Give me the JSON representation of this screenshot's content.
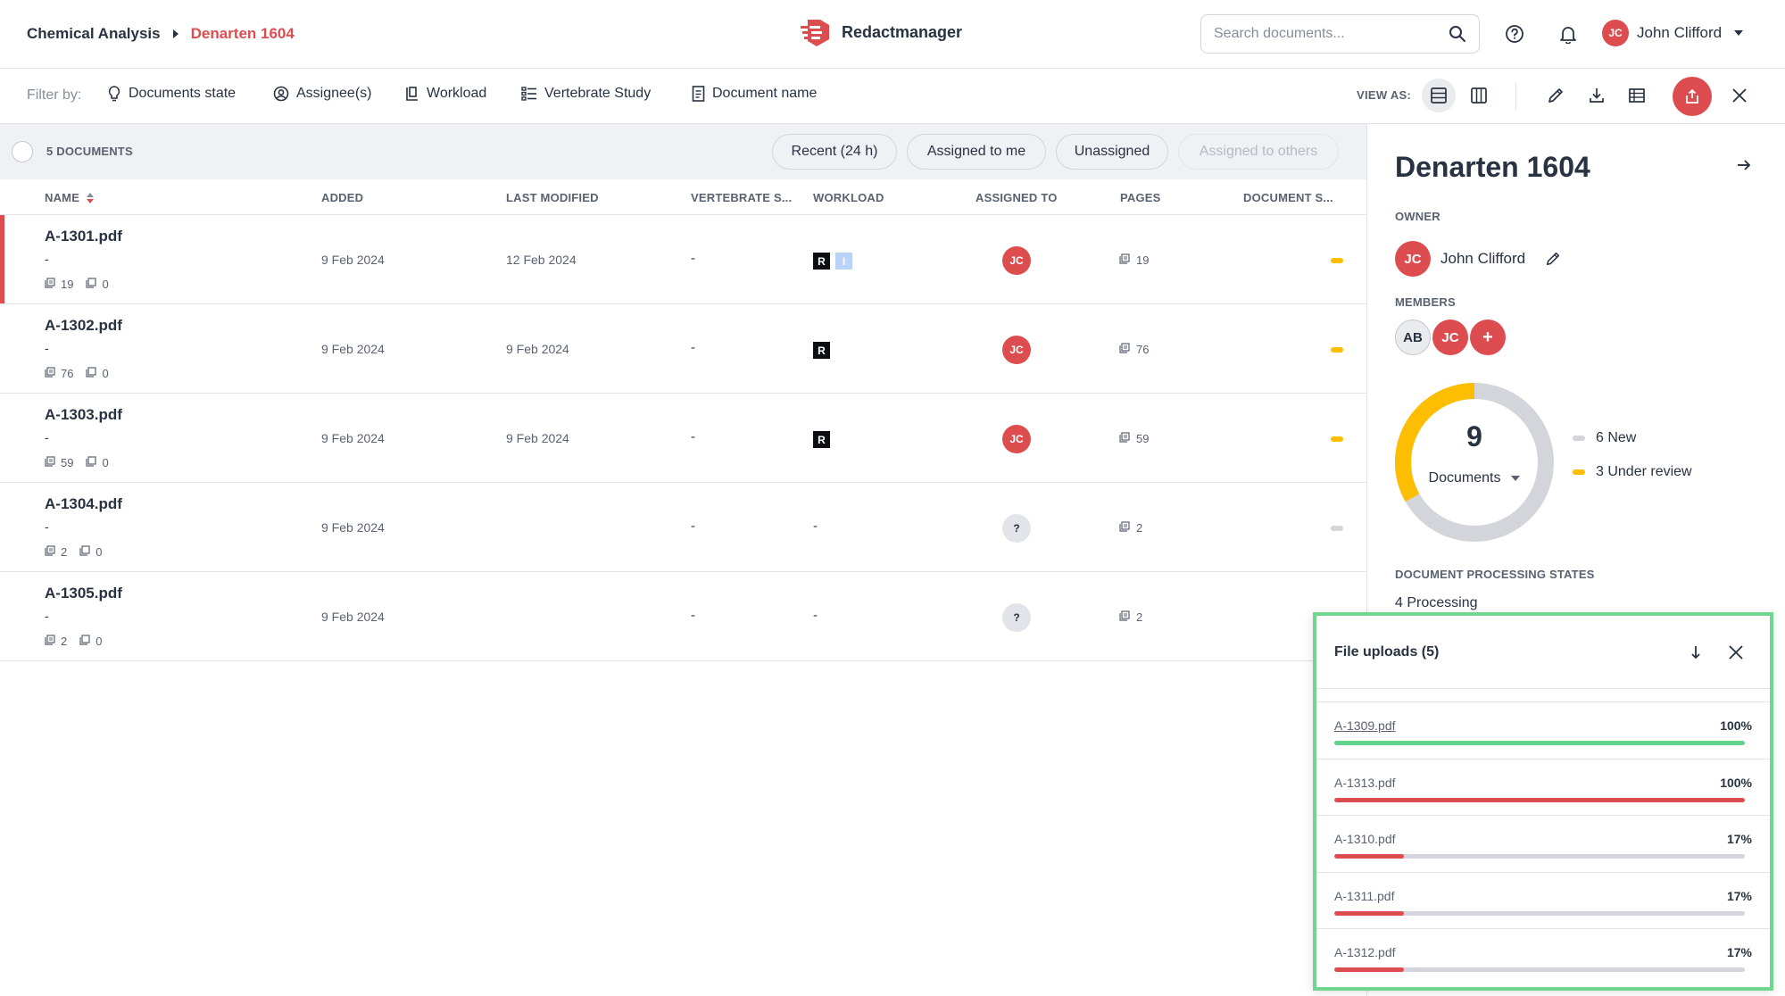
{
  "header": {
    "breadcrumb_root": "Chemical Analysis",
    "breadcrumb_current": "Denarten 1604",
    "app_name": "Redactmanager",
    "search_placeholder": "Search documents...",
    "user_initials": "JC",
    "user_name": "John Clifford"
  },
  "filters": {
    "label": "Filter by:",
    "items": [
      "Documents state",
      "Assignee(s)",
      "Workload",
      "Vertebrate Study",
      "Document name"
    ],
    "view_as_label": "VIEW AS:"
  },
  "table": {
    "doc_count_label": "5 DOCUMENTS",
    "chips": [
      "Recent (24 h)",
      "Assigned to me",
      "Unassigned",
      "Assigned to others"
    ],
    "columns": [
      "NAME",
      "ADDED",
      "LAST MODIFIED",
      "VERTEBRATE S...",
      "WORKLOAD",
      "ASSIGNED TO",
      "PAGES",
      "DOCUMENT S..."
    ],
    "rows": [
      {
        "name": "A-1301.pdf",
        "subtitle": "-",
        "pages_meta": "19",
        "annotations_meta": "0",
        "added": "9 Feb 2024",
        "last_modified": "12 Feb 2024",
        "vertebrate": "-",
        "workload": [
          "R",
          "I"
        ],
        "assignee": "JC",
        "pages": "19",
        "state_color": "#fdbd00"
      },
      {
        "name": "A-1302.pdf",
        "subtitle": "-",
        "pages_meta": "76",
        "annotations_meta": "0",
        "added": "9 Feb 2024",
        "last_modified": "9 Feb 2024",
        "vertebrate": "-",
        "workload": [
          "R"
        ],
        "assignee": "JC",
        "pages": "76",
        "state_color": "#fdbd00"
      },
      {
        "name": "A-1303.pdf",
        "subtitle": "-",
        "pages_meta": "59",
        "annotations_meta": "0",
        "added": "9 Feb 2024",
        "last_modified": "9 Feb 2024",
        "vertebrate": "-",
        "workload": [
          "R"
        ],
        "assignee": "JC",
        "pages": "59",
        "state_color": "#fdbd00"
      },
      {
        "name": "A-1304.pdf",
        "subtitle": "-",
        "pages_meta": "2",
        "annotations_meta": "0",
        "added": "9 Feb 2024",
        "last_modified": "",
        "vertebrate": "-",
        "workload_text": "-",
        "assignee": "?",
        "pages": "2",
        "state_color": "#d3d5da"
      },
      {
        "name": "A-1305.pdf",
        "subtitle": "-",
        "pages_meta": "2",
        "annotations_meta": "0",
        "added": "9 Feb 2024",
        "last_modified": "",
        "vertebrate": "-",
        "workload_text": "-",
        "assignee": "?",
        "pages": "2",
        "state_color": "#d3d5da"
      }
    ]
  },
  "panel": {
    "title": "Denarten 1604",
    "owner_label": "OWNER",
    "owner_initials": "JC",
    "owner_name": "John Clifford",
    "members_label": "MEMBERS",
    "members": [
      "AB",
      "JC",
      "+"
    ],
    "donut_total": "9",
    "donut_label": "Documents",
    "donut_new_fraction": 0.667,
    "legend": [
      {
        "label": "6 New",
        "color": "#d3d5da"
      },
      {
        "label": "3 Under review",
        "color": "#fdbd00"
      }
    ],
    "processing_label": "DOCUMENT PROCESSING STATES",
    "processing_value": "4 Processing"
  },
  "uploads": {
    "title": "File uploads (5)",
    "items": [
      {
        "name": "A-1309.pdf",
        "percent": "100%",
        "progress": 1.0,
        "color": "#5fd38a",
        "link": true
      },
      {
        "name": "A-1313.pdf",
        "percent": "100%",
        "progress": 1.0,
        "color": "#dd4d50",
        "link": false
      },
      {
        "name": "A-1310.pdf",
        "percent": "17%",
        "progress": 0.17,
        "color": "#dd4d50",
        "link": false
      },
      {
        "name": "A-1311.pdf",
        "percent": "17%",
        "progress": 0.17,
        "color": "#dd4d50",
        "link": false
      },
      {
        "name": "A-1312.pdf",
        "percent": "17%",
        "progress": 0.17,
        "color": "#dd4d50",
        "link": false
      }
    ]
  },
  "colors": {
    "accent": "#dd4d50",
    "under_review": "#fdbd00",
    "new": "#d3d5da",
    "upload_highlight": "#6ed68f"
  },
  "icons": [
    "search-icon",
    "help-icon",
    "bell-icon",
    "lightbulb-icon",
    "user-circle-icon",
    "workload-icon",
    "list-icon",
    "document-icon",
    "list-view-icon",
    "column-view-icon",
    "pencil-icon",
    "download-icon",
    "table-icon",
    "upload-icon",
    "close-icon",
    "arrow-right-icon",
    "arrow-down-icon",
    "pages-icon",
    "annotations-icon"
  ]
}
